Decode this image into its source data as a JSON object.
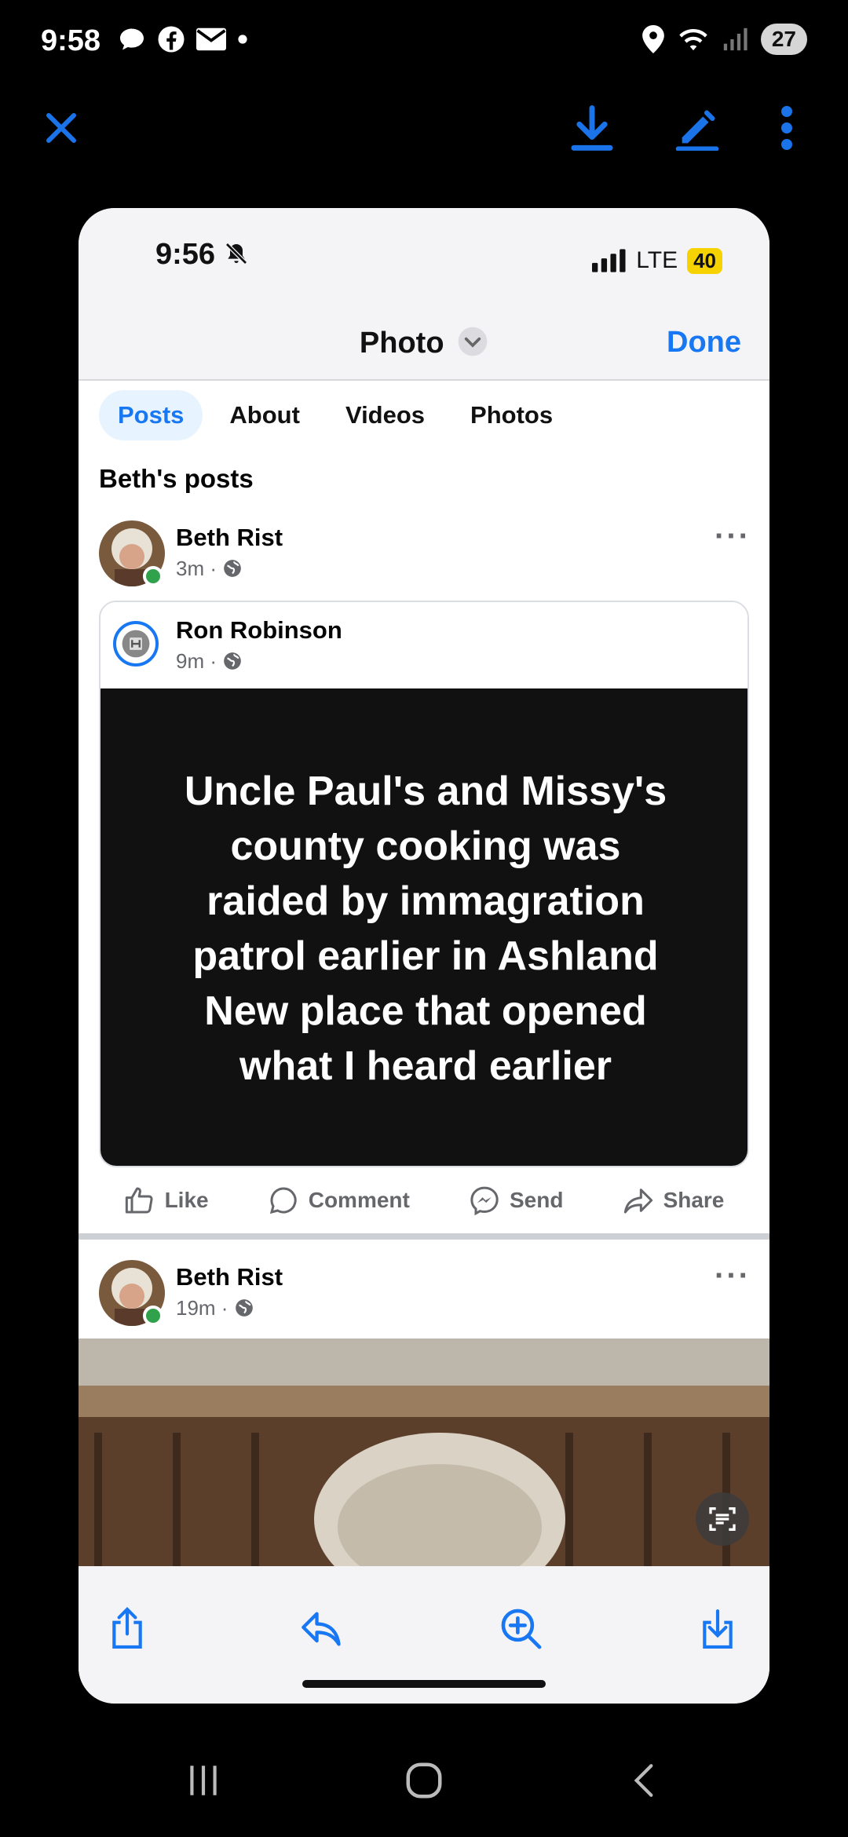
{
  "status_bar": {
    "time": "9:58",
    "icons": [
      "chat-bubble-icon",
      "facebook-icon",
      "mail-icon",
      "dot-icon"
    ],
    "right_icons": [
      "location-icon",
      "wifi-icon",
      "signal-icon"
    ],
    "battery": "27"
  },
  "viewer_toolbar": {
    "close": "close-icon",
    "download": "download-icon",
    "edit": "edit-icon",
    "more": "more-vertical-icon"
  },
  "screenshot": {
    "status": {
      "time": "9:56",
      "network": "LTE",
      "battery": "40"
    },
    "nav": {
      "title": "Photo",
      "done": "Done"
    },
    "tabs": [
      "Posts",
      "About",
      "Videos",
      "Photos"
    ],
    "active_tab": "Posts",
    "section_title": "Beth's posts",
    "post1": {
      "author": "Beth Rist",
      "time": "3m ·"
    },
    "shared_post": {
      "author": "Ron Robinson",
      "time": "9m ·",
      "text": "Uncle Paul's and Missy's\ncounty cooking was\nraided by immagration\npatrol earlier in Ashland\nNew place that opened\nwhat I heard earlier"
    },
    "actions": {
      "like": "Like",
      "comment": "Comment",
      "send": "Send",
      "share": "Share"
    },
    "post2": {
      "author": "Beth Rist",
      "time": "19m ·"
    }
  },
  "colors": {
    "facebook_blue": "#1877f2",
    "viewer_blue": "#1a73e8",
    "online_green": "#31a24c"
  }
}
